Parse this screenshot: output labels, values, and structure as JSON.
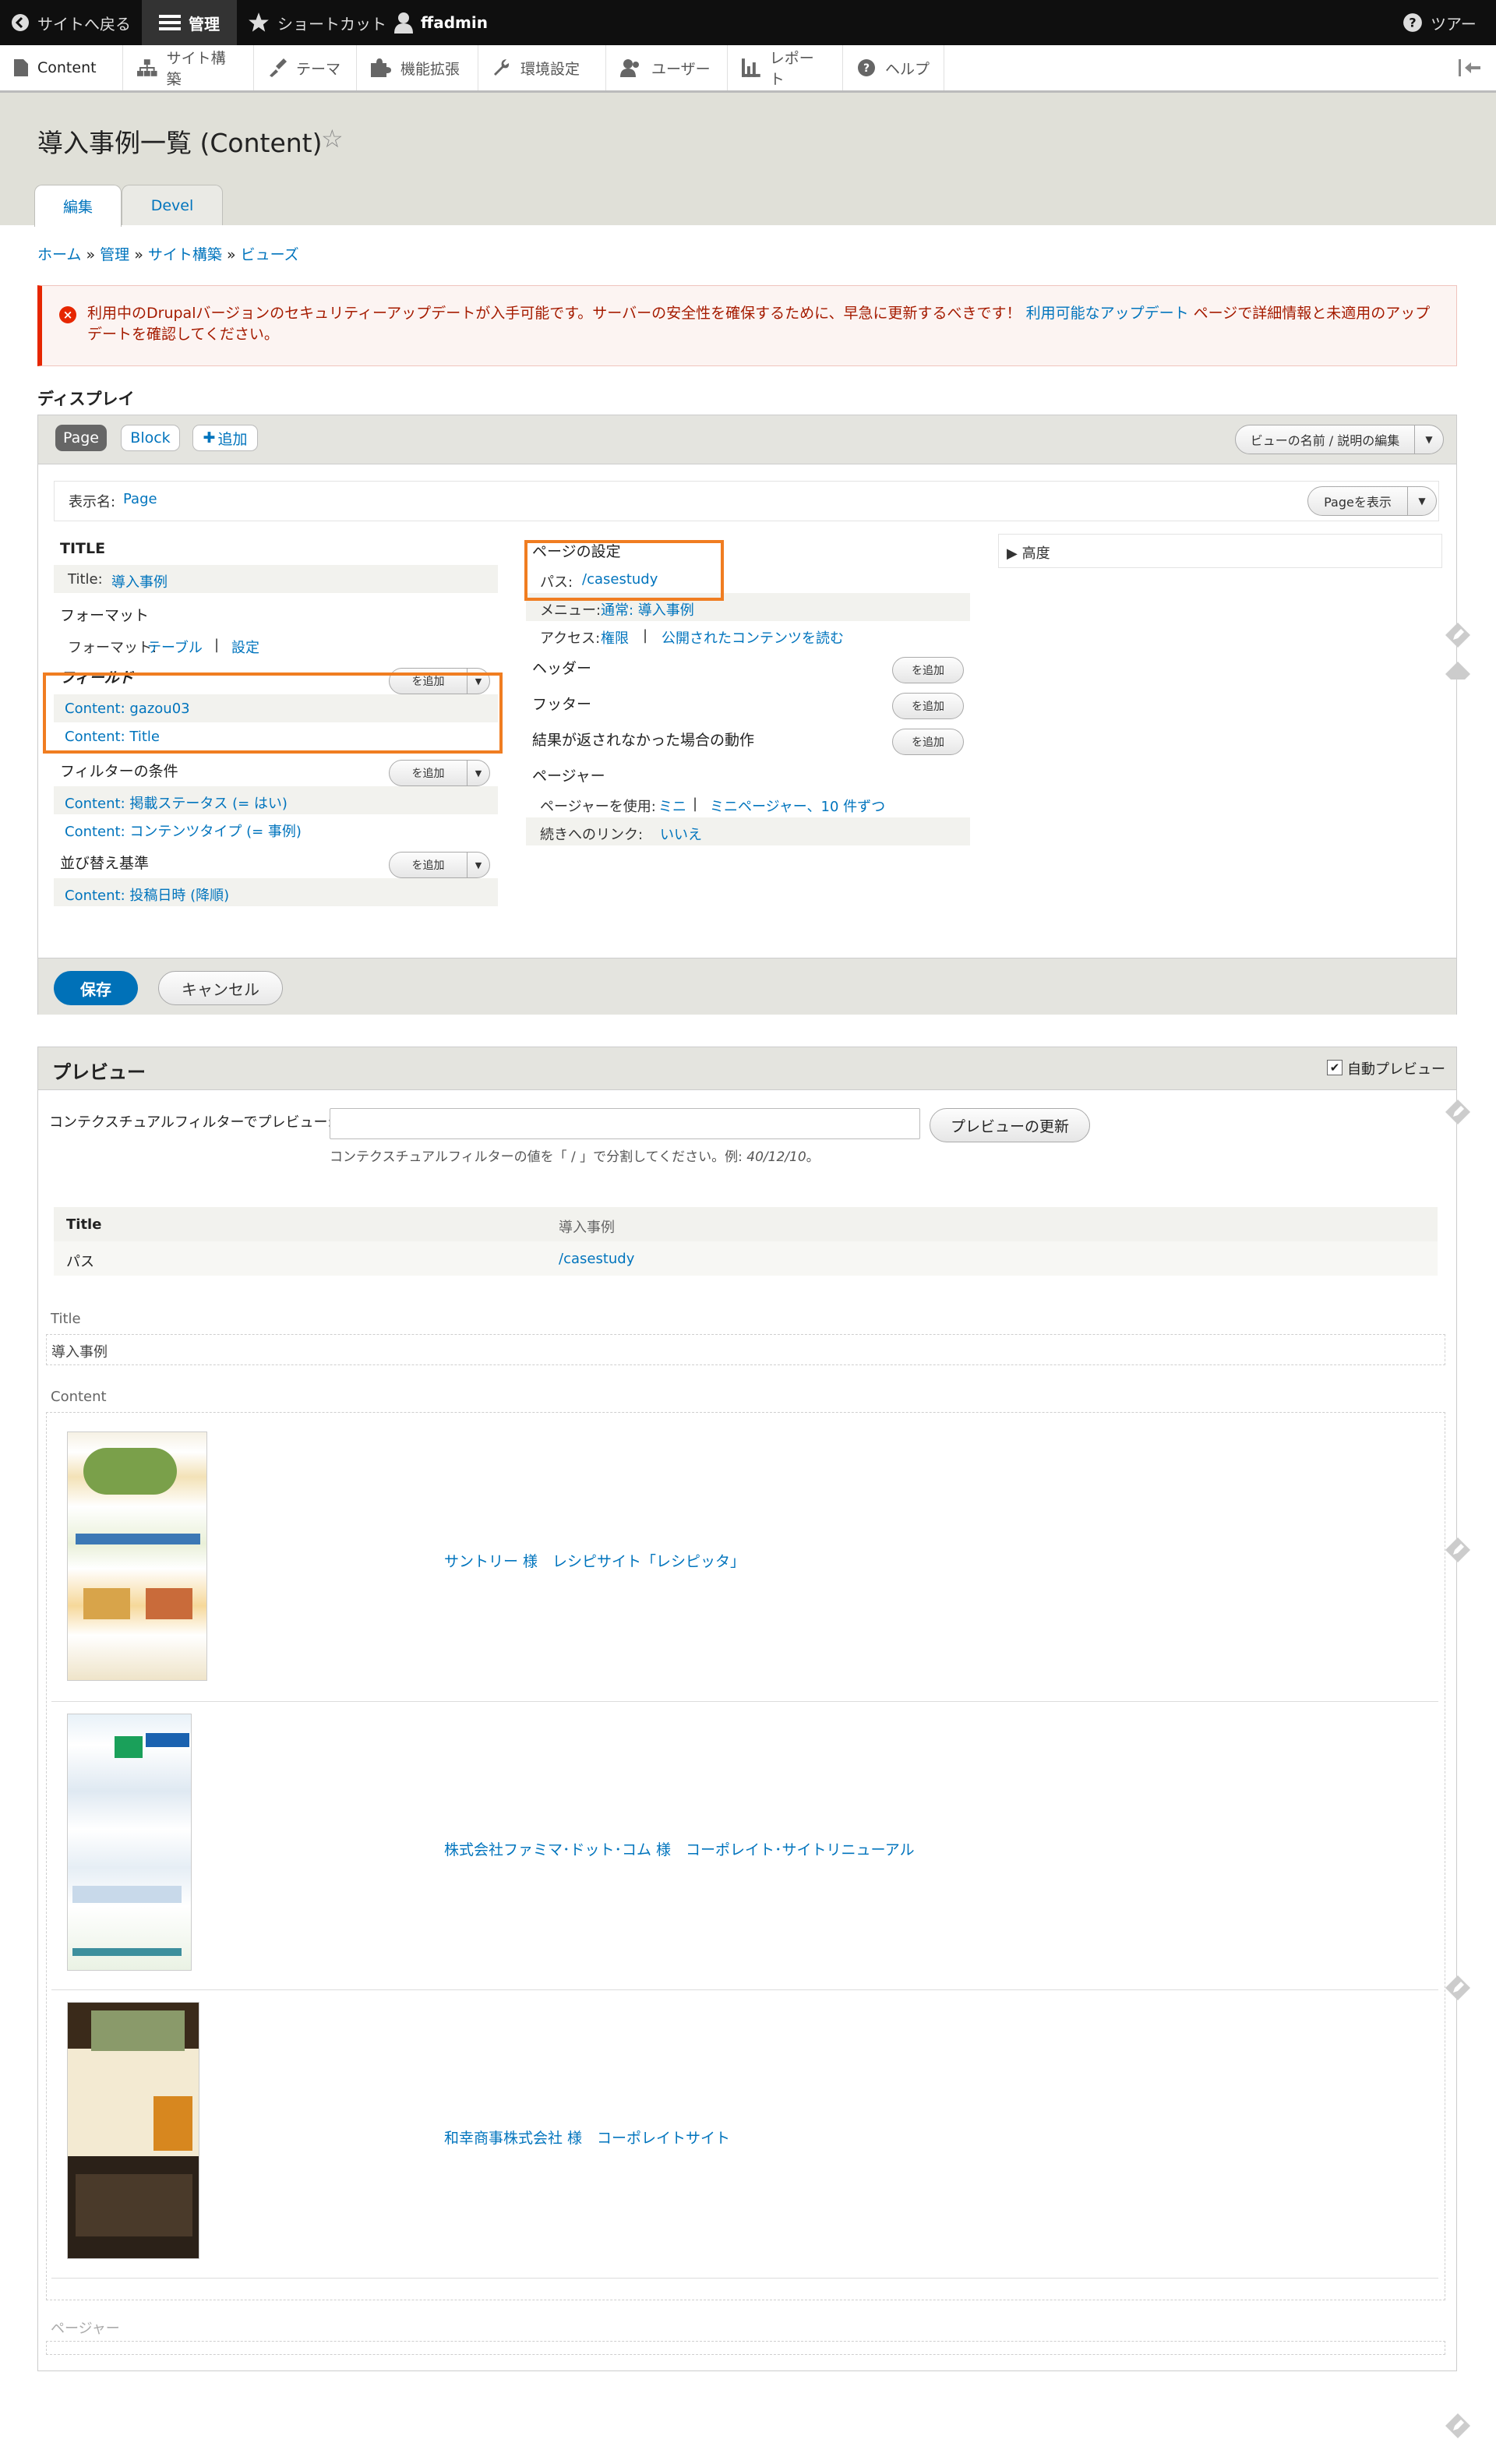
{
  "toolbar": {
    "back": "サイトへ戻る",
    "manage": "管理",
    "shortcuts": "ショートカット",
    "user": "ffadmin",
    "tour": "ツアー"
  },
  "tray": {
    "items": [
      "Content",
      "サイト構築",
      "テーマ",
      "機能拡張",
      "環境設定",
      "ユーザー",
      "レポート",
      "ヘルプ"
    ]
  },
  "header": {
    "title": "導入事例一覧 (Content)",
    "tabs": [
      "編集",
      "Devel"
    ]
  },
  "breadcrumb": {
    "items": [
      "ホーム",
      "管理",
      "サイト構築",
      "ビューズ"
    ],
    "separator": "»"
  },
  "alert": {
    "text_before": "利用中のDrupalバージョンのセキュリティーアップデートが入手可能です。サーバーの安全性を確保するために、早急に更新するべきです！",
    "link": "利用可能なアップデート",
    "text_after": "ページで詳細情報と未適用のアップデートを確認してください。"
  },
  "display": {
    "heading": "ディスプレイ",
    "tabs": [
      "Page",
      "Block"
    ],
    "add": "追加",
    "edit_view": "ビューの名前 / 説明の編集",
    "display_name_label": "表示名:",
    "display_name_value": "Page",
    "view_page": "Pageを表示",
    "col1": {
      "title_heading": "TITLE",
      "title_label": "Title:",
      "title_value": "導入事例",
      "format_heading": "フォーマット",
      "format_label": "フォーマット:",
      "format_value": "テーブル",
      "format_settings": "設定",
      "fields_heading": "フィールド",
      "fields": [
        "Content: gazou03",
        "Content: Title"
      ],
      "filter_heading": "フィルターの条件",
      "filters": [
        "Content: 掲載ステータス (= はい)",
        "Content: コンテンツタイプ (= 事例)"
      ],
      "sort_heading": "並び替え基準",
      "sorts": [
        "Content: 投稿日時 (降順)"
      ],
      "add_label": "を追加"
    },
    "col2": {
      "page_settings": "ページの設定",
      "path_label": "パス:",
      "path_value": "/casestudy",
      "menu_label": "メニュー:",
      "menu_value": "通常: 導入事例",
      "access_label": "アクセス:",
      "access_value1": "権限",
      "access_value2": "公開されたコンテンツを読む",
      "header": "ヘッダー",
      "footer": "フッター",
      "no_results": "結果が返されなかった場合の動作",
      "pager": "ページャー",
      "pager_label": "ページャーを使用:",
      "pager_value1": "ミニ",
      "pager_value2": "ミニページャー、10 件ずつ",
      "more_label": "続きへのリンク:",
      "more_value": "いいえ",
      "add_label": "を追加"
    },
    "col3": {
      "advanced": "▶ 高度"
    },
    "save": "保存",
    "cancel": "キャンセル"
  },
  "preview": {
    "heading": "プレビュー",
    "auto_preview": "自動プレビュー",
    "filter_label": "コンテクスチュアルフィルターでプレビュー:",
    "filter_value": "",
    "update_button": "プレビューの更新",
    "hint_before": "コンテクスチュアルフィルターの値を「 / 」で分割してください。例:",
    "hint_example": "40/12/10",
    "hint_after": "。",
    "info_table": [
      {
        "label": "Title",
        "value": "導入事例"
      },
      {
        "label": "パス",
        "value": "/casestudy"
      }
    ],
    "title_label": "Title",
    "title_value": "導入事例",
    "content_label": "Content",
    "results": [
      "サントリー 様　レシピサイト「レシピッタ」",
      "株式会社ファミマ･ドット･コム 様　コーポレイト･サイトリニューアル",
      "和幸商事株式会社 様　コーポレイトサイト"
    ],
    "pager_label": "ページャー"
  },
  "colors": {
    "link": "#0074bd",
    "highlight": "#f07d21",
    "error": "#e62600",
    "primary_button": "#0071b8"
  }
}
